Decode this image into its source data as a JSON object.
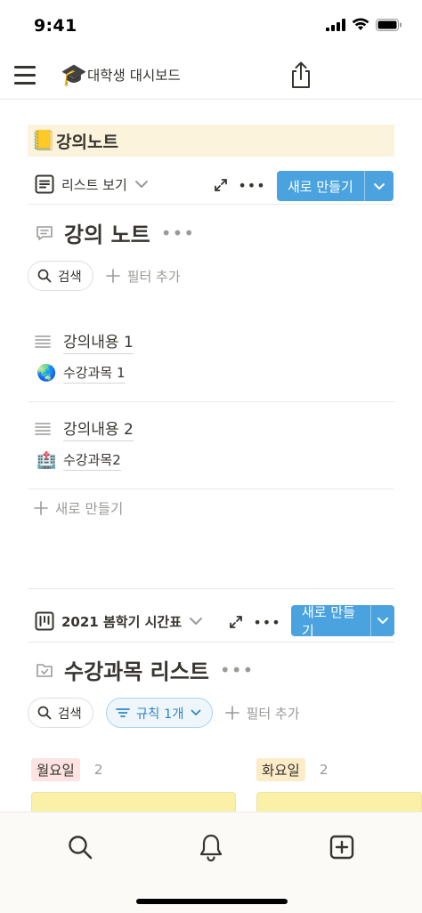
{
  "status_bar": {
    "time": "9:41"
  },
  "nav": {
    "page_emoji": "🎓",
    "page_title": "대학생 대시보드"
  },
  "banner": {
    "emoji": "📒",
    "title": "강의노트"
  },
  "db1": {
    "view_label": "리스트 보기",
    "new_label": "새로 만들기",
    "title": "강의 노트",
    "more": "•••",
    "search_label": "검색",
    "add_filter_label": "필터 추가",
    "items": [
      {
        "title": "강의내용 1",
        "prop_emoji": "🌏",
        "prop_text": "수강과목 1"
      },
      {
        "title": "강의내용 2",
        "prop_emoji": "🏥",
        "prop_text": "수강과목2"
      }
    ],
    "add_row_label": "새로 만들기"
  },
  "db2": {
    "view_label": "2021 봄학기 시간표",
    "new_label": "새로 만들기",
    "title": "수강과목 리스트",
    "more": "•••",
    "search_label": "검색",
    "rule_label": "규칙 1개",
    "add_filter_label": "필터 추가",
    "columns": [
      {
        "label": "월요일",
        "count": "2",
        "color": "#fde3e1"
      },
      {
        "label": "화요일",
        "count": "2",
        "color": "#fdecc8"
      }
    ]
  },
  "colors": {
    "accent": "#4aa3df",
    "banner_bg": "#fbf3db",
    "card_bg": "#fbf0a8"
  },
  "bottom_bar": {
    "icons": [
      "search-icon",
      "bell-icon",
      "add-page-icon"
    ]
  }
}
